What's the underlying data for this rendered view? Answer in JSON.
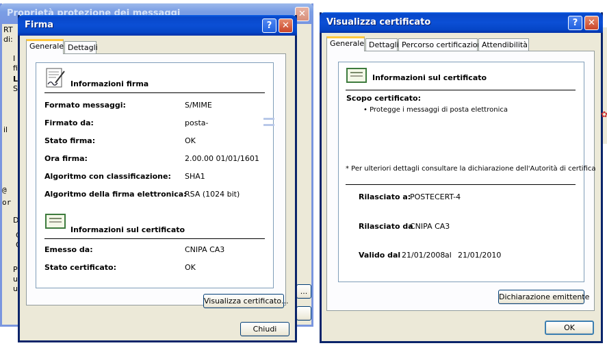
{
  "bg_window1": {
    "title": "Proprietà protezione dei messaggi",
    "left_fragments": [
      "RT",
      "di:",
      "I",
      "fi",
      "L",
      "Se",
      "il",
      "@",
      "or",
      "D",
      "C",
      "O",
      "P",
      "ul",
      "u"
    ],
    "button_fragment": "..."
  },
  "firma": {
    "title": "Firma",
    "tabs": [
      "Generale",
      "Dettagli"
    ],
    "section1_title": "Informazioni firma",
    "fields": [
      {
        "label": "Formato messaggi:",
        "value": "S/MIME"
      },
      {
        "label": "Firmato da:",
        "value": "posta-"
      },
      {
        "label": "Stato firma:",
        "value": "OK"
      },
      {
        "label": "Ora firma:",
        "value": "2.00.00 01/01/1601"
      },
      {
        "label": "Algoritmo con classificazione:",
        "value": "SHA1"
      },
      {
        "label": "Algoritmo della firma elettronica:",
        "value": "RSA (1024 bit)"
      }
    ],
    "section2_title": "Informazioni sul certificato",
    "cert_fields": [
      {
        "label": "Emesso da:",
        "value": "CNIPA CA3"
      },
      {
        "label": "Stato certificato:",
        "value": "OK"
      }
    ],
    "view_cert_button": "Visualizza certificato...",
    "close_button": "Chiudi"
  },
  "cert": {
    "title": "Visualizza certificato",
    "tabs": [
      "Generale",
      "Dettagli",
      "Percorso certificazione",
      "Attendibilità"
    ],
    "header": "Informazioni sul certificato",
    "scope_title": "Scopo certificato:",
    "scope_items": [
      "Protegge i messaggi di posta elettronica"
    ],
    "note": "* Per ulteriori dettagli consultare la dichiarazione dell'Autorità di certifica",
    "issued_to_label": "Rilasciato a:",
    "issued_to_value": "POSTECERT-4",
    "issued_by_label": "Rilasciato da",
    "issued_by_value": "CNIPA CA3",
    "valid_label": "Valido dal",
    "valid_from": "21/01/2008",
    "valid_sep": "al",
    "valid_to": "21/01/2010",
    "issuer_statement_button": "Dichiarazione emittente",
    "ok_button": "OK"
  }
}
